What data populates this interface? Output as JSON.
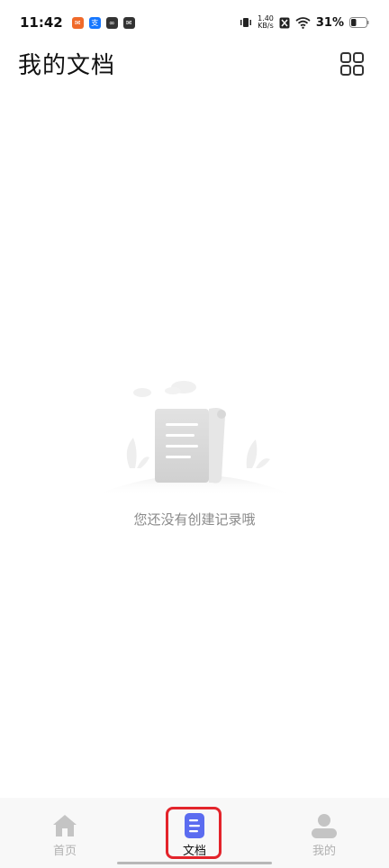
{
  "status_bar": {
    "time": "11:42",
    "net_speed_value": "1.40",
    "net_speed_unit": "KB/s",
    "battery": "31%"
  },
  "header": {
    "title": "我的文档"
  },
  "empty_state": {
    "message": "您还没有创建记录哦"
  },
  "bottom_nav": {
    "items": [
      {
        "label": "首页",
        "icon": "home-icon",
        "active": false
      },
      {
        "label": "文档",
        "icon": "document-icon",
        "active": true
      },
      {
        "label": "我的",
        "icon": "user-icon",
        "active": false
      }
    ]
  },
  "colors": {
    "accent": "#5b6cf0",
    "highlight": "#e3242b",
    "inactive": "#b0b0b0"
  }
}
